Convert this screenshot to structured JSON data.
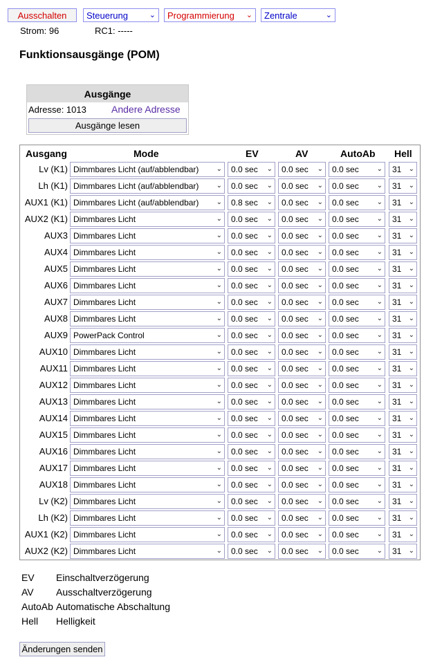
{
  "topbar": {
    "off_button": "Ausschalten",
    "steuerung": "Steuerung",
    "programmierung": "Programmierung",
    "zentrale": "Zentrale"
  },
  "status": {
    "strom": "Strom: 96",
    "rc1": "RC1: -----"
  },
  "page_title": "Funktionsausgänge (POM)",
  "outputs_box": {
    "header": "Ausgänge",
    "address": "Adresse: 1013",
    "other_address": "Andere Adresse",
    "read_button": "Ausgänge lesen"
  },
  "grid": {
    "headers": {
      "ausgang": "Ausgang",
      "mode": "Mode",
      "ev": "EV",
      "av": "AV",
      "autoab": "AutoAb",
      "hell": "Hell"
    },
    "rows": [
      {
        "name": "Lv (K1)",
        "mode": "Dimmbares Licht (auf/abblendbar)",
        "ev": "0.0 sec",
        "av": "0.0 sec",
        "autoab": "0.0 sec",
        "hell": "31"
      },
      {
        "name": "Lh (K1)",
        "mode": "Dimmbares Licht (auf/abblendbar)",
        "ev": "0.0 sec",
        "av": "0.0 sec",
        "autoab": "0.0 sec",
        "hell": "31"
      },
      {
        "name": "AUX1 (K1)",
        "mode": "Dimmbares Licht (auf/abblendbar)",
        "ev": "0.8 sec",
        "av": "0.0 sec",
        "autoab": "0.0 sec",
        "hell": "31"
      },
      {
        "name": "AUX2 (K1)",
        "mode": "Dimmbares Licht",
        "ev": "0.0 sec",
        "av": "0.0 sec",
        "autoab": "0.0 sec",
        "hell": "31"
      },
      {
        "name": "AUX3",
        "mode": "Dimmbares Licht",
        "ev": "0.0 sec",
        "av": "0.0 sec",
        "autoab": "0.0 sec",
        "hell": "31"
      },
      {
        "name": "AUX4",
        "mode": "Dimmbares Licht",
        "ev": "0.0 sec",
        "av": "0.0 sec",
        "autoab": "0.0 sec",
        "hell": "31"
      },
      {
        "name": "AUX5",
        "mode": "Dimmbares Licht",
        "ev": "0.0 sec",
        "av": "0.0 sec",
        "autoab": "0.0 sec",
        "hell": "31"
      },
      {
        "name": "AUX6",
        "mode": "Dimmbares Licht",
        "ev": "0.0 sec",
        "av": "0.0 sec",
        "autoab": "0.0 sec",
        "hell": "31"
      },
      {
        "name": "AUX7",
        "mode": "Dimmbares Licht",
        "ev": "0.0 sec",
        "av": "0.0 sec",
        "autoab": "0.0 sec",
        "hell": "31"
      },
      {
        "name": "AUX8",
        "mode": "Dimmbares Licht",
        "ev": "0.0 sec",
        "av": "0.0 sec",
        "autoab": "0.0 sec",
        "hell": "31"
      },
      {
        "name": "AUX9",
        "mode": "PowerPack Control",
        "ev": "0.0 sec",
        "av": "0.0 sec",
        "autoab": "0.0 sec",
        "hell": "31"
      },
      {
        "name": "AUX10",
        "mode": "Dimmbares Licht",
        "ev": "0.0 sec",
        "av": "0.0 sec",
        "autoab": "0.0 sec",
        "hell": "31"
      },
      {
        "name": "AUX11",
        "mode": "Dimmbares Licht",
        "ev": "0.0 sec",
        "av": "0.0 sec",
        "autoab": "0.0 sec",
        "hell": "31"
      },
      {
        "name": "AUX12",
        "mode": "Dimmbares Licht",
        "ev": "0.0 sec",
        "av": "0.0 sec",
        "autoab": "0.0 sec",
        "hell": "31"
      },
      {
        "name": "AUX13",
        "mode": "Dimmbares Licht",
        "ev": "0.0 sec",
        "av": "0.0 sec",
        "autoab": "0.0 sec",
        "hell": "31"
      },
      {
        "name": "AUX14",
        "mode": "Dimmbares Licht",
        "ev": "0.0 sec",
        "av": "0.0 sec",
        "autoab": "0.0 sec",
        "hell": "31"
      },
      {
        "name": "AUX15",
        "mode": "Dimmbares Licht",
        "ev": "0.0 sec",
        "av": "0.0 sec",
        "autoab": "0.0 sec",
        "hell": "31"
      },
      {
        "name": "AUX16",
        "mode": "Dimmbares Licht",
        "ev": "0.0 sec",
        "av": "0.0 sec",
        "autoab": "0.0 sec",
        "hell": "31"
      },
      {
        "name": "AUX17",
        "mode": "Dimmbares Licht",
        "ev": "0.0 sec",
        "av": "0.0 sec",
        "autoab": "0.0 sec",
        "hell": "31"
      },
      {
        "name": "AUX18",
        "mode": "Dimmbares Licht",
        "ev": "0.0 sec",
        "av": "0.0 sec",
        "autoab": "0.0 sec",
        "hell": "31"
      },
      {
        "name": "Lv (K2)",
        "mode": "Dimmbares Licht",
        "ev": "0.0 sec",
        "av": "0.0 sec",
        "autoab": "0.0 sec",
        "hell": "31"
      },
      {
        "name": "Lh (K2)",
        "mode": "Dimmbares Licht",
        "ev": "0.0 sec",
        "av": "0.0 sec",
        "autoab": "0.0 sec",
        "hell": "31"
      },
      {
        "name": "AUX1 (K2)",
        "mode": "Dimmbares Licht",
        "ev": "0.0 sec",
        "av": "0.0 sec",
        "autoab": "0.0 sec",
        "hell": "31"
      },
      {
        "name": "AUX2 (K2)",
        "mode": "Dimmbares Licht",
        "ev": "0.0 sec",
        "av": "0.0 sec",
        "autoab": "0.0 sec",
        "hell": "31"
      }
    ]
  },
  "legend": [
    {
      "key": "EV",
      "desc": "Einschaltverzögerung"
    },
    {
      "key": "AV",
      "desc": "Ausschaltverzögerung"
    },
    {
      "key": "AutoAb",
      "desc": "Automatische Abschaltung"
    },
    {
      "key": "Hell",
      "desc": "Helligkeit"
    }
  ],
  "send_button": "Änderungen senden",
  "icons": {
    "dropdown": "chevron-down-icon"
  },
  "colors": {
    "accent_blue": "#0000c8",
    "accent_red": "#d40000",
    "link_purple": "#5a2ea6"
  }
}
